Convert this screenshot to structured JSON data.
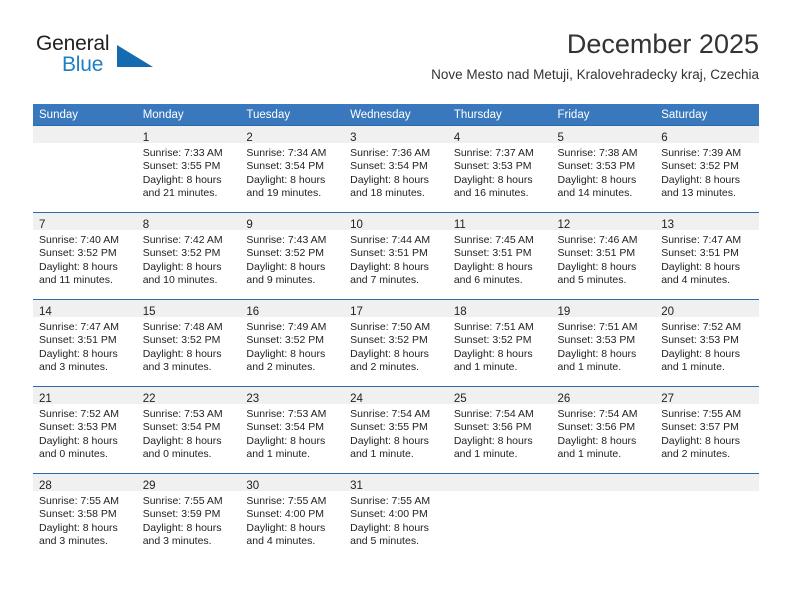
{
  "brand": {
    "name_part1": "General",
    "name_part2": "Blue",
    "triangle_color": "#156bb0",
    "blue_text_color": "#1f7fc4"
  },
  "header": {
    "title": "December 2025",
    "subtitle": "Nove Mesto nad Metuji, Kralovehradecky kraj, Czechia"
  },
  "theme": {
    "header_row_bg": "#3a78bd",
    "header_row_text": "#ffffff",
    "row_separator": "#2c6aa8",
    "daynum_band_bg": "#f0f0f0"
  },
  "calendar": {
    "weekday_headers": [
      "Sunday",
      "Monday",
      "Tuesday",
      "Wednesday",
      "Thursday",
      "Friday",
      "Saturday"
    ],
    "weeks": [
      [
        {
          "day": "",
          "sunrise": "",
          "sunset": "",
          "daylight_line1": "",
          "daylight_line2": ""
        },
        {
          "day": "1",
          "sunrise": "Sunrise: 7:33 AM",
          "sunset": "Sunset: 3:55 PM",
          "daylight_line1": "Daylight: 8 hours",
          "daylight_line2": "and 21 minutes."
        },
        {
          "day": "2",
          "sunrise": "Sunrise: 7:34 AM",
          "sunset": "Sunset: 3:54 PM",
          "daylight_line1": "Daylight: 8 hours",
          "daylight_line2": "and 19 minutes."
        },
        {
          "day": "3",
          "sunrise": "Sunrise: 7:36 AM",
          "sunset": "Sunset: 3:54 PM",
          "daylight_line1": "Daylight: 8 hours",
          "daylight_line2": "and 18 minutes."
        },
        {
          "day": "4",
          "sunrise": "Sunrise: 7:37 AM",
          "sunset": "Sunset: 3:53 PM",
          "daylight_line1": "Daylight: 8 hours",
          "daylight_line2": "and 16 minutes."
        },
        {
          "day": "5",
          "sunrise": "Sunrise: 7:38 AM",
          "sunset": "Sunset: 3:53 PM",
          "daylight_line1": "Daylight: 8 hours",
          "daylight_line2": "and 14 minutes."
        },
        {
          "day": "6",
          "sunrise": "Sunrise: 7:39 AM",
          "sunset": "Sunset: 3:52 PM",
          "daylight_line1": "Daylight: 8 hours",
          "daylight_line2": "and 13 minutes."
        }
      ],
      [
        {
          "day": "7",
          "sunrise": "Sunrise: 7:40 AM",
          "sunset": "Sunset: 3:52 PM",
          "daylight_line1": "Daylight: 8 hours",
          "daylight_line2": "and 11 minutes."
        },
        {
          "day": "8",
          "sunrise": "Sunrise: 7:42 AM",
          "sunset": "Sunset: 3:52 PM",
          "daylight_line1": "Daylight: 8 hours",
          "daylight_line2": "and 10 minutes."
        },
        {
          "day": "9",
          "sunrise": "Sunrise: 7:43 AM",
          "sunset": "Sunset: 3:52 PM",
          "daylight_line1": "Daylight: 8 hours",
          "daylight_line2": "and 9 minutes."
        },
        {
          "day": "10",
          "sunrise": "Sunrise: 7:44 AM",
          "sunset": "Sunset: 3:51 PM",
          "daylight_line1": "Daylight: 8 hours",
          "daylight_line2": "and 7 minutes."
        },
        {
          "day": "11",
          "sunrise": "Sunrise: 7:45 AM",
          "sunset": "Sunset: 3:51 PM",
          "daylight_line1": "Daylight: 8 hours",
          "daylight_line2": "and 6 minutes."
        },
        {
          "day": "12",
          "sunrise": "Sunrise: 7:46 AM",
          "sunset": "Sunset: 3:51 PM",
          "daylight_line1": "Daylight: 8 hours",
          "daylight_line2": "and 5 minutes."
        },
        {
          "day": "13",
          "sunrise": "Sunrise: 7:47 AM",
          "sunset": "Sunset: 3:51 PM",
          "daylight_line1": "Daylight: 8 hours",
          "daylight_line2": "and 4 minutes."
        }
      ],
      [
        {
          "day": "14",
          "sunrise": "Sunrise: 7:47 AM",
          "sunset": "Sunset: 3:51 PM",
          "daylight_line1": "Daylight: 8 hours",
          "daylight_line2": "and 3 minutes."
        },
        {
          "day": "15",
          "sunrise": "Sunrise: 7:48 AM",
          "sunset": "Sunset: 3:52 PM",
          "daylight_line1": "Daylight: 8 hours",
          "daylight_line2": "and 3 minutes."
        },
        {
          "day": "16",
          "sunrise": "Sunrise: 7:49 AM",
          "sunset": "Sunset: 3:52 PM",
          "daylight_line1": "Daylight: 8 hours",
          "daylight_line2": "and 2 minutes."
        },
        {
          "day": "17",
          "sunrise": "Sunrise: 7:50 AM",
          "sunset": "Sunset: 3:52 PM",
          "daylight_line1": "Daylight: 8 hours",
          "daylight_line2": "and 2 minutes."
        },
        {
          "day": "18",
          "sunrise": "Sunrise: 7:51 AM",
          "sunset": "Sunset: 3:52 PM",
          "daylight_line1": "Daylight: 8 hours",
          "daylight_line2": "and 1 minute."
        },
        {
          "day": "19",
          "sunrise": "Sunrise: 7:51 AM",
          "sunset": "Sunset: 3:53 PM",
          "daylight_line1": "Daylight: 8 hours",
          "daylight_line2": "and 1 minute."
        },
        {
          "day": "20",
          "sunrise": "Sunrise: 7:52 AM",
          "sunset": "Sunset: 3:53 PM",
          "daylight_line1": "Daylight: 8 hours",
          "daylight_line2": "and 1 minute."
        }
      ],
      [
        {
          "day": "21",
          "sunrise": "Sunrise: 7:52 AM",
          "sunset": "Sunset: 3:53 PM",
          "daylight_line1": "Daylight: 8 hours",
          "daylight_line2": "and 0 minutes."
        },
        {
          "day": "22",
          "sunrise": "Sunrise: 7:53 AM",
          "sunset": "Sunset: 3:54 PM",
          "daylight_line1": "Daylight: 8 hours",
          "daylight_line2": "and 0 minutes."
        },
        {
          "day": "23",
          "sunrise": "Sunrise: 7:53 AM",
          "sunset": "Sunset: 3:54 PM",
          "daylight_line1": "Daylight: 8 hours",
          "daylight_line2": "and 1 minute."
        },
        {
          "day": "24",
          "sunrise": "Sunrise: 7:54 AM",
          "sunset": "Sunset: 3:55 PM",
          "daylight_line1": "Daylight: 8 hours",
          "daylight_line2": "and 1 minute."
        },
        {
          "day": "25",
          "sunrise": "Sunrise: 7:54 AM",
          "sunset": "Sunset: 3:56 PM",
          "daylight_line1": "Daylight: 8 hours",
          "daylight_line2": "and 1 minute."
        },
        {
          "day": "26",
          "sunrise": "Sunrise: 7:54 AM",
          "sunset": "Sunset: 3:56 PM",
          "daylight_line1": "Daylight: 8 hours",
          "daylight_line2": "and 1 minute."
        },
        {
          "day": "27",
          "sunrise": "Sunrise: 7:55 AM",
          "sunset": "Sunset: 3:57 PM",
          "daylight_line1": "Daylight: 8 hours",
          "daylight_line2": "and 2 minutes."
        }
      ],
      [
        {
          "day": "28",
          "sunrise": "Sunrise: 7:55 AM",
          "sunset": "Sunset: 3:58 PM",
          "daylight_line1": "Daylight: 8 hours",
          "daylight_line2": "and 3 minutes."
        },
        {
          "day": "29",
          "sunrise": "Sunrise: 7:55 AM",
          "sunset": "Sunset: 3:59 PM",
          "daylight_line1": "Daylight: 8 hours",
          "daylight_line2": "and 3 minutes."
        },
        {
          "day": "30",
          "sunrise": "Sunrise: 7:55 AM",
          "sunset": "Sunset: 4:00 PM",
          "daylight_line1": "Daylight: 8 hours",
          "daylight_line2": "and 4 minutes."
        },
        {
          "day": "31",
          "sunrise": "Sunrise: 7:55 AM",
          "sunset": "Sunset: 4:00 PM",
          "daylight_line1": "Daylight: 8 hours",
          "daylight_line2": "and 5 minutes."
        },
        {
          "day": "",
          "sunrise": "",
          "sunset": "",
          "daylight_line1": "",
          "daylight_line2": ""
        },
        {
          "day": "",
          "sunrise": "",
          "sunset": "",
          "daylight_line1": "",
          "daylight_line2": ""
        },
        {
          "day": "",
          "sunrise": "",
          "sunset": "",
          "daylight_line1": "",
          "daylight_line2": ""
        }
      ]
    ]
  }
}
